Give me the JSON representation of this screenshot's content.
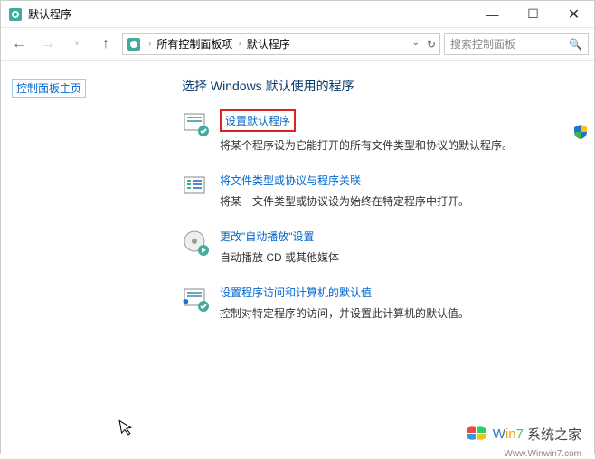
{
  "window": {
    "title": "默认程序"
  },
  "nav": {
    "breadcrumb": [
      "所有控制面板项",
      "默认程序"
    ],
    "search_placeholder": "搜索控制面板"
  },
  "sidebar": {
    "home_link": "控制面板主页"
  },
  "main": {
    "heading": "选择 Windows 默认使用的程序",
    "options": [
      {
        "title": "设置默认程序",
        "desc": "将某个程序设为它能打开的所有文件类型和协议的默认程序。",
        "highlighted": true
      },
      {
        "title": "将文件类型或协议与程序关联",
        "desc": "将某一文件类型或协议设为始终在特定程序中打开。",
        "highlighted": false
      },
      {
        "title": "更改\"自动播放\"设置",
        "desc": "自动播放 CD 或其他媒体",
        "highlighted": false
      },
      {
        "title": "设置程序访问和计算机的默认值",
        "desc": "控制对特定程序的访问，并设置此计算机的默认值。",
        "highlighted": false
      }
    ]
  },
  "watermark": {
    "brand": "Win7",
    "text": "系统之家",
    "url": "Www.Winwin7.com"
  }
}
